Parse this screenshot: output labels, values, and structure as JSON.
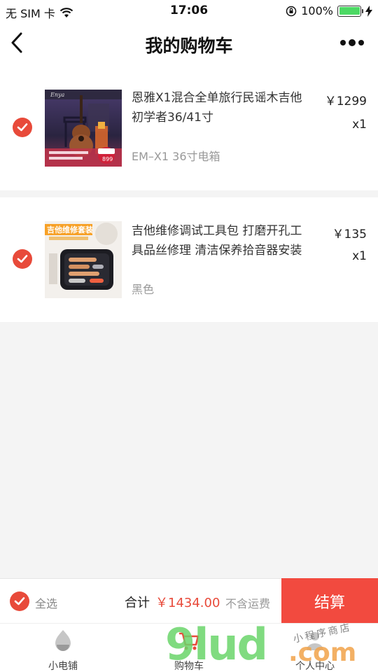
{
  "status_bar": {
    "carrier": "无 SIM 卡",
    "time": "17:06",
    "battery_percent": "100%",
    "battery_level": 1.0
  },
  "nav": {
    "title": "我的购物车"
  },
  "cart_items": [
    {
      "title": "恩雅X1混合全单旅行民谣木吉他初学者36/41寸",
      "spec": "EM–X1 36寸电箱",
      "price": "￥1299",
      "quantity": "x1",
      "selected": true,
      "image_badge": "899"
    },
    {
      "title": "吉他维修调试工具包 打磨开孔工具品丝修理 清洁保养拾音器安装",
      "spec": "黑色",
      "price": "￥135",
      "quantity": "x1",
      "selected": true,
      "image_banner": "吉他维修套装"
    }
  ],
  "checkout": {
    "select_all_label": "全选",
    "total_label": "合计",
    "total_amount": "￥1434.00",
    "shipping_note": "不含运费",
    "checkout_label": "结算"
  },
  "tab_bar": {
    "tabs": [
      {
        "label": "小电铺",
        "icon": "shop-icon"
      },
      {
        "label": "购物车",
        "icon": "cart-icon"
      },
      {
        "label": "个人中心",
        "icon": "profile-icon"
      }
    ]
  },
  "watermark": {
    "main": "9lud",
    "domain": ".com",
    "tagline": "小程序商店"
  },
  "colors": {
    "accent": "#e84a3a",
    "checkout_button": "#f24a3f",
    "battery": "#4cd964"
  }
}
